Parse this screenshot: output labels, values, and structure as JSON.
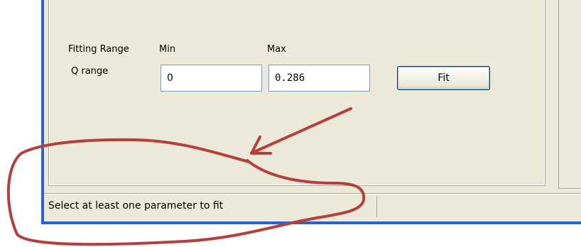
{
  "fitting": {
    "range_label": "Fitting Range",
    "min_label": "Min",
    "max_label": "Max",
    "q_range_label": "Q range",
    "min_value": "0",
    "max_value": "0.286",
    "fit_button_label": "Fit"
  },
  "status_bar": {
    "message": "Select at least one parameter to fit"
  },
  "colors": {
    "window_frame": "#2a62d6",
    "panel_bg": "#ece9d8",
    "annotation": "#b3403c"
  }
}
